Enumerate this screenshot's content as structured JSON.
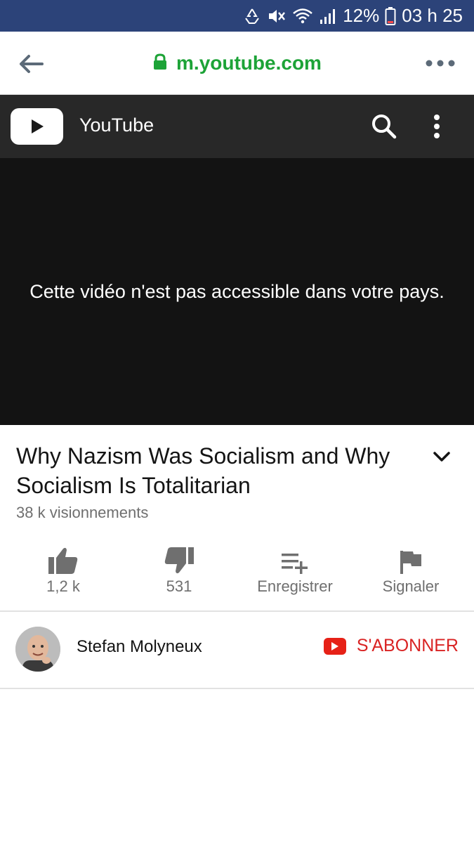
{
  "status_bar": {
    "battery_percent": "12%",
    "time": "03 h 25",
    "icons": [
      "recycle-icon",
      "mute-icon",
      "wifi-icon",
      "signal-icon",
      "battery-icon"
    ]
  },
  "browser": {
    "url": "m.youtube.com",
    "url_color": "#1da337",
    "icons": [
      "back-arrow-icon",
      "lock-icon",
      "more-dots-icon"
    ]
  },
  "youtube_header": {
    "title": "YouTube",
    "icons": [
      "youtube-logo-icon",
      "search-icon",
      "kebab-menu-icon"
    ]
  },
  "player": {
    "message": "Cette vidéo n'est pas accessible dans votre pays."
  },
  "video": {
    "title": "Why Nazism Was Socialism and Why Socialism Is Totalitarian",
    "views": "38 k visionnements"
  },
  "actions": {
    "like_label": "1,2 k",
    "dislike_label": "531",
    "save_label": "Enregistrer",
    "report_label": "Signaler"
  },
  "channel": {
    "name": "Stefan Molyneux",
    "subscribe_label": "S'ABONNER",
    "subscribe_color": "#e62117"
  }
}
